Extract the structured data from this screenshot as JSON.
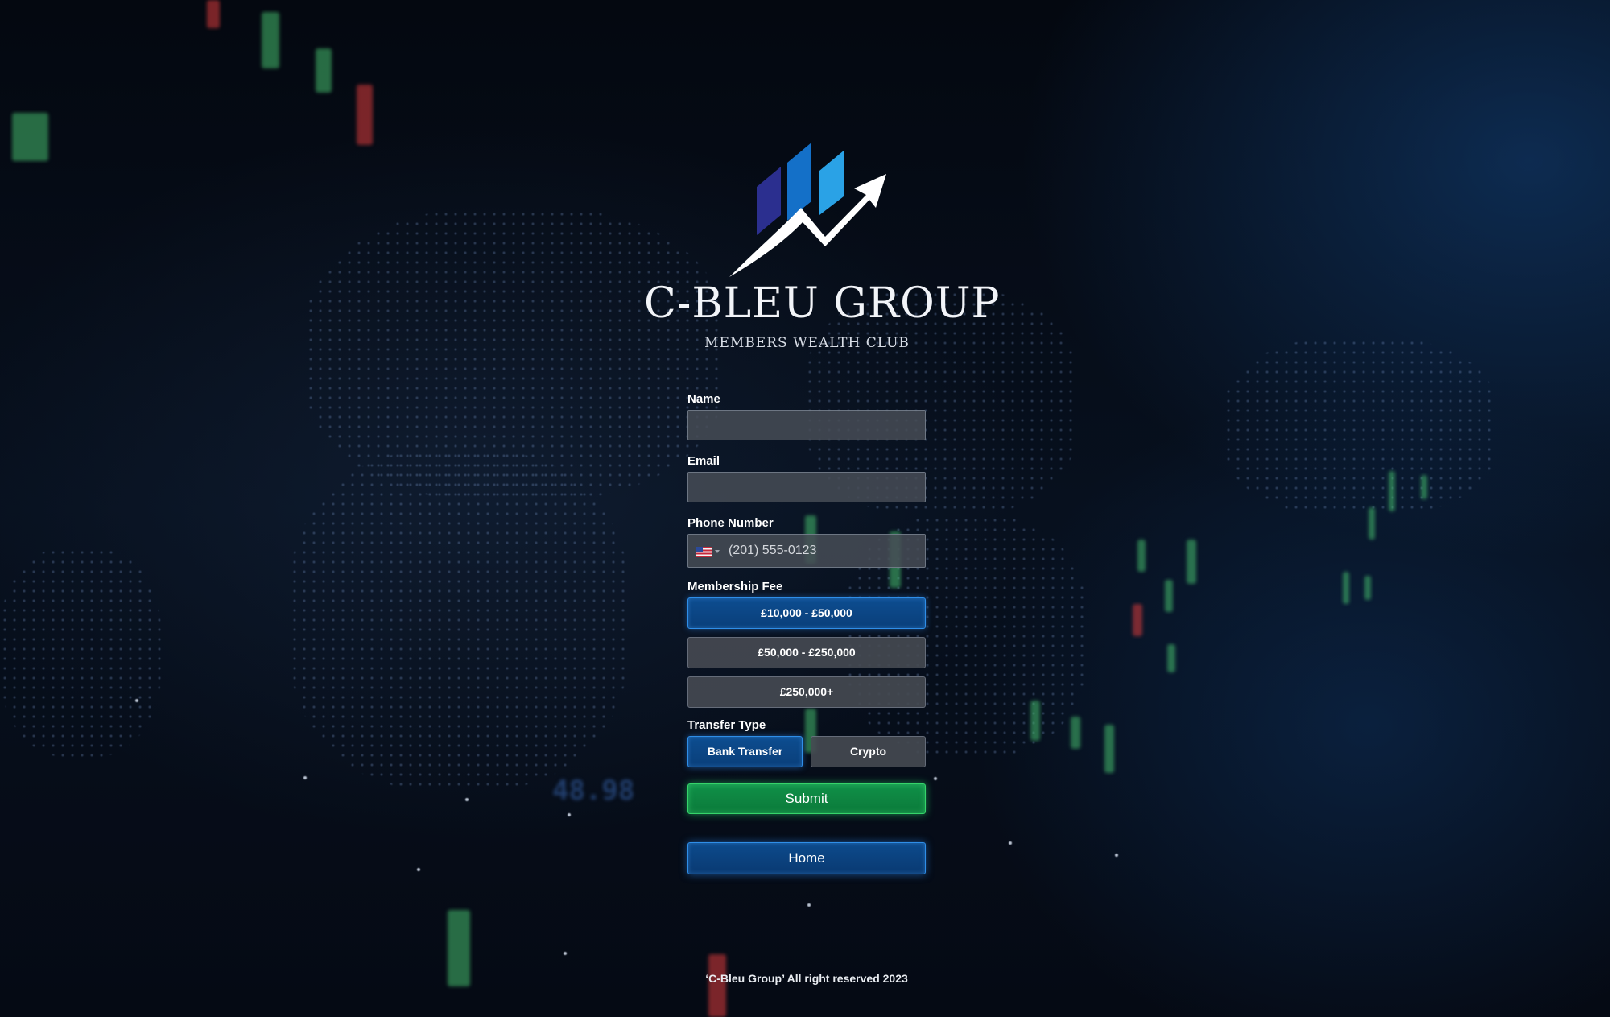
{
  "brand": {
    "name": "C-BLEU GROUP",
    "tagline": "MEMBERS WEALTH CLUB",
    "logo_icon": "rising-chart-arrow-logo",
    "colors": {
      "bar_dark": "#2b2f8f",
      "bar_mid": "#1470c8",
      "bar_light": "#2aa2e6",
      "arrow": "#ffffff"
    }
  },
  "form": {
    "name_label": "Name",
    "name_value": "",
    "email_label": "Email",
    "email_value": "",
    "phone_label": "Phone Number",
    "phone_placeholder": "(201) 555-0123",
    "phone_country_icon": "us-flag-icon",
    "fee_label": "Membership Fee",
    "fee_options": [
      {
        "label": "£10,000 - £50,000",
        "selected": true
      },
      {
        "label": "£50,000 - £250,000",
        "selected": false
      },
      {
        "label": "£250,000+",
        "selected": false
      }
    ],
    "transfer_label": "Transfer Type",
    "transfer_options": [
      {
        "label": "Bank Transfer",
        "selected": true
      },
      {
        "label": "Crypto",
        "selected": false
      }
    ],
    "submit_label": "Submit",
    "home_label": "Home"
  },
  "footer": {
    "text": "‘C-Bleu Group’ All right reserved 2023"
  },
  "background": {
    "ticker": "48.98"
  },
  "colors": {
    "selected_blue": "#0d4d90",
    "selected_border": "#2f8ee8",
    "submit_green": "#109048",
    "submit_border": "#36d46a",
    "field_bg": "#464c56"
  }
}
